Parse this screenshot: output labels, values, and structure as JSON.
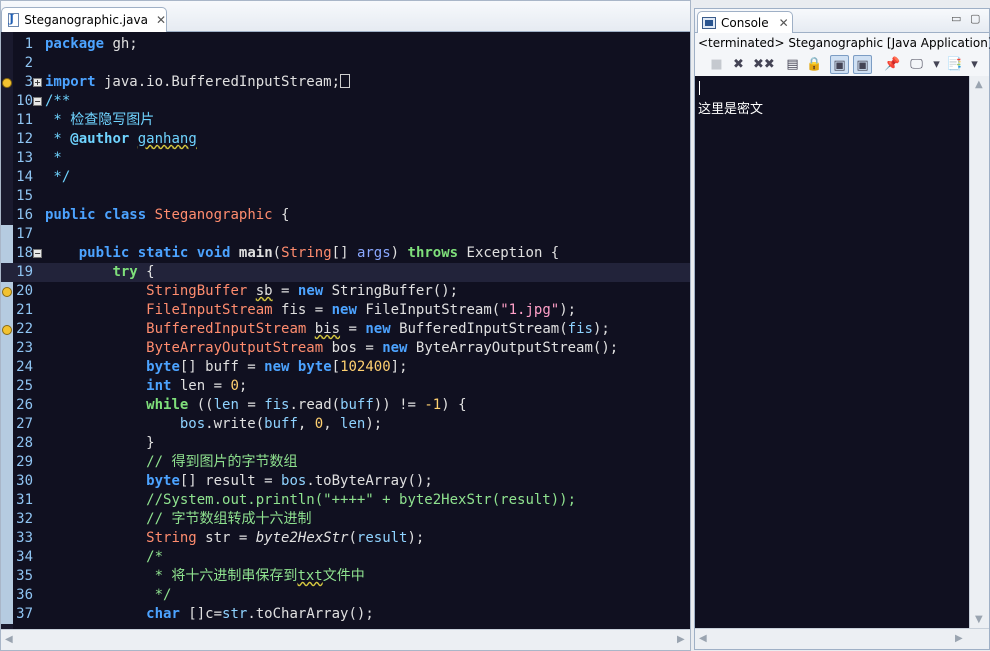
{
  "editor": {
    "tab_title": "Steganographic.java",
    "tab_close": "✕",
    "lines": [
      {
        "n": "1",
        "fold": "",
        "html": "<span class=\"kw\">package</span> gh;"
      },
      {
        "n": "2",
        "fold": "",
        "html": ""
      },
      {
        "n": "3",
        "fold": "+",
        "warn": true,
        "html": "<span class=\"kw\">import</span> java.io.BufferedInputStream;<span class=\"collapsed-box\"></span>"
      },
      {
        "n": "10",
        "fold": "−",
        "html": "<span class=\"dc\">/**</span>"
      },
      {
        "n": "11",
        "fold": "",
        "html": "<span class=\"dc\"> * 检查隐写图片</span>"
      },
      {
        "n": "12",
        "fold": "",
        "html": "<span class=\"dc\"> * <b>@author</b> <span class=\"under\">ganhang</span></span>"
      },
      {
        "n": "13",
        "fold": "",
        "html": "<span class=\"dc\"> *</span>"
      },
      {
        "n": "14",
        "fold": "",
        "html": "<span class=\"dc\"> */</span>"
      },
      {
        "n": "15",
        "fold": "",
        "html": ""
      },
      {
        "n": "16",
        "fold": "",
        "html": "<span class=\"kw\">public</span> <span class=\"kw\">class</span> <span class=\"ty\">Steganographic</span> {"
      },
      {
        "n": "17",
        "fold": "",
        "html": ""
      },
      {
        "n": "18",
        "fold": "−",
        "html": "    <span class=\"kw\">public</span> <span class=\"kw\">static</span> <span class=\"kw\">void</span> <b>main</b>(<span class=\"ty\">String</span>[] <span class=\"pa\">args</span>) <span class=\"kwo\">throws</span> Exception {"
      },
      {
        "n": "19",
        "fold": "",
        "current": true,
        "html": "        <span class=\"kwo\">try</span> {"
      },
      {
        "n": "20",
        "fold": "",
        "warn": true,
        "html": "            <span class=\"ty\">StringBuffer</span> <span class=\"under\">sb</span> = <span class=\"kw\">new</span> StringBuffer();"
      },
      {
        "n": "21",
        "fold": "",
        "html": "            <span class=\"ty\">FileInputStream</span> fis = <span class=\"kw\">new</span> FileInputStream(<span class=\"st\">\"1.jpg\"</span>);"
      },
      {
        "n": "22",
        "fold": "",
        "warn": true,
        "html": "            <span class=\"ty\">BufferedInputStream</span> <span class=\"under\">bis</span> = <span class=\"kw\">new</span> BufferedInputStream(<span class=\"fi\">fis</span>);"
      },
      {
        "n": "23",
        "fold": "",
        "html": "            <span class=\"ty\">ByteArrayOutputStream</span> bos = <span class=\"kw\">new</span> ByteArrayOutputStream();"
      },
      {
        "n": "24",
        "fold": "",
        "html": "            <span class=\"kw\">byte</span>[] buff = <span class=\"kw\">new</span> <span class=\"kw\">byte</span>[<span class=\"nu\">102400</span>];"
      },
      {
        "n": "25",
        "fold": "",
        "html": "            <span class=\"kw\">int</span> len = <span class=\"nu\">0</span>;"
      },
      {
        "n": "26",
        "fold": "",
        "html": "            <span class=\"kwo\">while</span> ((<span class=\"fi\">len</span> = <span class=\"fi\">fis</span>.read(<span class=\"fi\">buff</span>)) != <span class=\"nu\">-1</span>) {"
      },
      {
        "n": "27",
        "fold": "",
        "html": "                <span class=\"fi\">bos</span>.write(<span class=\"fi\">buff</span>, <span class=\"nu\">0</span>, <span class=\"fi\">len</span>);"
      },
      {
        "n": "28",
        "fold": "",
        "html": "            }"
      },
      {
        "n": "29",
        "fold": "",
        "html": "            <span class=\"cm\">// 得到图片的字节数组</span>"
      },
      {
        "n": "30",
        "fold": "",
        "html": "            <span class=\"kw\">byte</span>[] result = <span class=\"fi\">bos</span>.toByteArray();"
      },
      {
        "n": "31",
        "fold": "",
        "html": "            <span class=\"cm\">//System.out.println(\"++++\" + byte2HexStr(result));</span>"
      },
      {
        "n": "32",
        "fold": "",
        "html": "            <span class=\"cm\">// 字节数组转成十六进制</span>"
      },
      {
        "n": "33",
        "fold": "",
        "html": "            <span class=\"ty\">String</span> str = <span class=\"it\">byte2HexStr</span>(<span class=\"fi\">result</span>);"
      },
      {
        "n": "34",
        "fold": "",
        "html": "            <span class=\"cm\">/*</span>"
      },
      {
        "n": "35",
        "fold": "",
        "html": "<span class=\"cm\">             * 将十六进制串保存到<span class=\"under\">txt</span>文件中</span>"
      },
      {
        "n": "36",
        "fold": "",
        "html": "<span class=\"cm\">             */</span>"
      },
      {
        "n": "37",
        "fold": "",
        "html": "            <span class=\"kw\">char</span> []c=<span class=\"fi\">str</span>.toCharArray();"
      }
    ]
  },
  "console": {
    "tab_title": "Console",
    "tab_close": "✕",
    "minimize": "▭",
    "maximize": "▢",
    "status": "<terminated> Steganographic [Java Application]",
    "output": "这里是密文",
    "toolbar": [
      {
        "name": "terminate-icon",
        "glyph": "■",
        "disabled": true
      },
      {
        "name": "remove-launch-icon",
        "glyph": "✖"
      },
      {
        "name": "remove-all-terminated-icon",
        "glyph": "✖✖"
      },
      {
        "name": "clear-console-icon",
        "glyph": "▤"
      },
      {
        "name": "scroll-lock-icon",
        "glyph": "🔒"
      },
      {
        "name": "show-on-stdout-icon",
        "glyph": "▣",
        "pressed": true
      },
      {
        "name": "show-on-stderr-icon",
        "glyph": "▣",
        "pressed": true
      },
      {
        "name": "pin-console-icon",
        "glyph": "📌"
      },
      {
        "name": "display-console-icon",
        "glyph": "🖵"
      },
      {
        "name": "display-dropdown-icon",
        "glyph": "▾"
      },
      {
        "name": "open-console-icon",
        "glyph": "📑"
      },
      {
        "name": "open-dropdown-icon",
        "glyph": "▾"
      }
    ]
  }
}
